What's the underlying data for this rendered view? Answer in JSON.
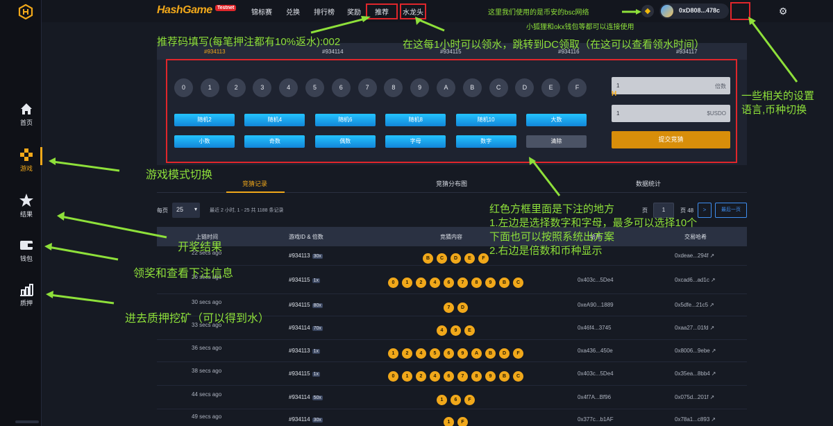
{
  "sidebar": {
    "logo_icon": "hash-logo-icon",
    "items": [
      {
        "label": "首页",
        "icon": "home-icon"
      },
      {
        "label": "游戏",
        "icon": "gamepad-icon"
      },
      {
        "label": "结果",
        "icon": "star-icon"
      },
      {
        "label": "钱包",
        "icon": "wallet-icon"
      },
      {
        "label": "质押",
        "icon": "stake-icon"
      }
    ]
  },
  "header": {
    "brand": "HashGame",
    "badge": "Testnet",
    "nav": [
      "锦标赛",
      "兑换",
      "排行榜",
      "奖励",
      "推荐",
      "水龙头"
    ],
    "wallet_address": "0xD808...478c"
  },
  "rounds": [
    "#934113",
    "#934114",
    "#934115",
    "#934116",
    "#934117"
  ],
  "bet": {
    "symbols": [
      "0",
      "1",
      "2",
      "3",
      "4",
      "5",
      "6",
      "7",
      "8",
      "9",
      "A",
      "B",
      "C",
      "D",
      "E",
      "F"
    ],
    "quick_row1": [
      "随机2",
      "随机4",
      "随机6",
      "随机8",
      "随机10",
      "大数"
    ],
    "quick_row2": [
      "小数",
      "奇数",
      "偶数",
      "字母",
      "数字",
      "清除"
    ],
    "multiplier_value": "1",
    "multiplier_unit": "倍数",
    "amount_value": "1",
    "amount_unit": "$USDO",
    "submit_label": "提交竞猜"
  },
  "records": {
    "tabs": [
      "竞猜记录",
      "竞猜分布图",
      "数据统计"
    ],
    "per_page_label": "每页",
    "per_page_value": "25",
    "summary": "最近 2 小时, 1 - 25 共 1188 条记录",
    "page_prev": "页",
    "page_value": "1",
    "page_total": "页 48",
    "next_label": ">",
    "last_label": "最后一页",
    "headers": [
      "上链时间",
      "游戏ID & 倍数",
      "竞猜内容",
      "哈希",
      "交易哈希"
    ],
    "rows": [
      {
        "time": "22 secs ago",
        "id": "#934113",
        "mult": "30x",
        "balls": [
          "B",
          "C",
          "D",
          "E",
          "F"
        ],
        "hash": "",
        "tx": "0xdeae...294f"
      },
      {
        "time": "26 secs ago",
        "id": "#934115",
        "mult": "1x",
        "balls": [
          "0",
          "1",
          "2",
          "4",
          "6",
          "7",
          "8",
          "9",
          "B",
          "C"
        ],
        "hash": "0x403c...5De4",
        "tx": "0xcad6...ad1c"
      },
      {
        "time": "30 secs ago",
        "id": "#934115",
        "mult": "80x",
        "balls": [
          "7",
          "D"
        ],
        "hash": "0xeA90...1889",
        "tx": "0x5dfe...21c5"
      },
      {
        "time": "33 secs ago",
        "id": "#934114",
        "mult": "70x",
        "balls": [
          "4",
          "9",
          "E"
        ],
        "hash": "0x46f4...3745",
        "tx": "0xaa27...01fd"
      },
      {
        "time": "36 secs ago",
        "id": "#934113",
        "mult": "1x",
        "balls": [
          "1",
          "2",
          "4",
          "5",
          "6",
          "9",
          "A",
          "B",
          "D",
          "F"
        ],
        "hash": "0xa436...450e",
        "tx": "0x8006...9ebe"
      },
      {
        "time": "38 secs ago",
        "id": "#934115",
        "mult": "1x",
        "balls": [
          "0",
          "1",
          "2",
          "4",
          "6",
          "7",
          "8",
          "9",
          "B",
          "C"
        ],
        "hash": "0x403c...5De4",
        "tx": "0x35ea...8bb4"
      },
      {
        "time": "44 secs ago",
        "id": "#934114",
        "mult": "50x",
        "balls": [
          "1",
          "6",
          "F"
        ],
        "hash": "0x4f7A...Bf96",
        "tx": "0x075d...201f"
      },
      {
        "time": "49 secs ago",
        "id": "#934114",
        "mult": "30x",
        "balls": [
          "1",
          "F"
        ],
        "hash": "0x377c...b1AF",
        "tx": "0x78a1...c893"
      }
    ]
  },
  "annotations": {
    "bsc": "这里我们使用的是币安的bsc网络",
    "wallets": "小狐狸和okx钱包等都可以连接使用",
    "referral": "推荐码填写(每笔押注都有10%返水):002",
    "faucet": "在这每1小时可以领水，跳转到DC领取（在这可以查看领水时间）",
    "settings": [
      "一些相关的设置",
      "语言,币种切换"
    ],
    "game_mode": "游戏模式切换",
    "results": "开奖结果",
    "wallet": "领奖和查看下注信息",
    "stake": "进去质押挖矿（可以得到水）",
    "bet_area": [
      "红色方框里面是下注的地方",
      "1.左边是选择数字和字母，最多可以选择10个",
      "下面也可以按照系统出方案",
      "2.右边是倍数和币种显示"
    ]
  },
  "colors": {
    "accent": "#f1a81a",
    "highlight": "#e0262b",
    "annotation": "#8ee03a",
    "button": "#1a9de6"
  }
}
